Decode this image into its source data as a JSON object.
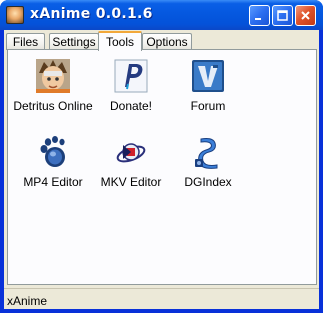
{
  "window": {
    "title": "xAnime 0.0.1.6",
    "controls": [
      "minimize-icon",
      "maximize-icon",
      "close-icon"
    ],
    "colors": {
      "titlebar": "#0558e0",
      "frame": "#0831d9",
      "body": "#ece9d8",
      "tab_highlight": "#f2a83a"
    }
  },
  "tabs": [
    {
      "label": "Files"
    },
    {
      "label": "Settings"
    },
    {
      "label": "Tools",
      "selected": true
    },
    {
      "label": "Options"
    }
  ],
  "tools": [
    {
      "label": "Detritus Online",
      "icon": "avatar-icon"
    },
    {
      "label": "Donate!",
      "icon": "paypal-icon"
    },
    {
      "label": "Forum",
      "icon": "forum-icon"
    },
    {
      "label": "MP4 Editor",
      "icon": "gnome-foot-icon"
    },
    {
      "label": "MKV Editor",
      "icon": "mkv-icon"
    },
    {
      "label": "DGIndex",
      "icon": "film-reel-icon"
    }
  ],
  "status": {
    "text": "xAnime"
  }
}
